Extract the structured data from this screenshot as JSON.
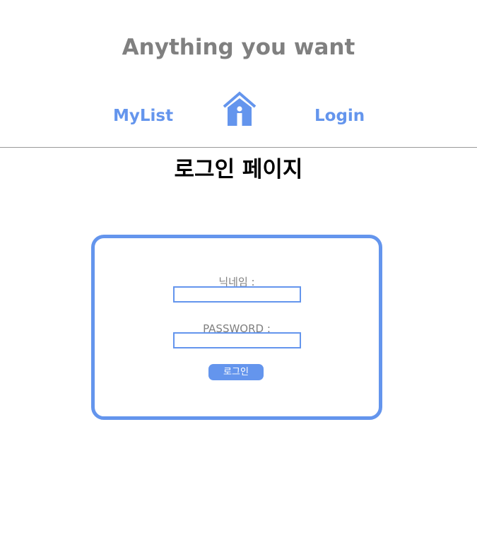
{
  "header": {
    "site_title": "Anything you want",
    "nav": {
      "mylist_label": "MyList",
      "home_icon": "home-icon",
      "login_label": "Login"
    }
  },
  "main": {
    "page_title": "로그인 페이지",
    "login_form": {
      "nickname_label": "닉네임 :",
      "nickname_value": "",
      "password_label": "PASSWORD :",
      "password_value": "",
      "submit_label": "로그인"
    }
  },
  "colors": {
    "accent": "#6495ed",
    "title_gray": "#808080",
    "divider": "#9a9a9a"
  }
}
